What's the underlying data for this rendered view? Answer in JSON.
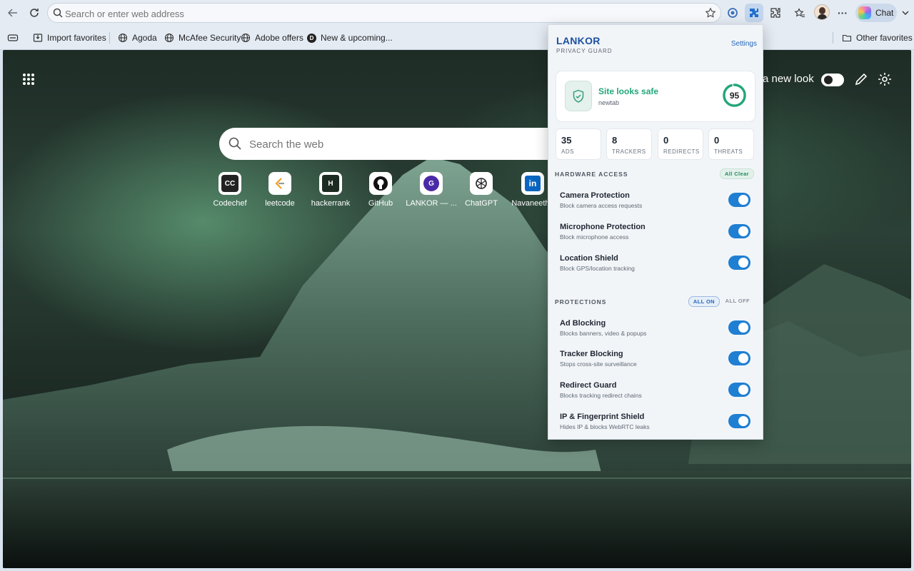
{
  "browser": {
    "address_placeholder": "Search or enter web address",
    "chat_label": "Chat",
    "more_label": "···"
  },
  "favorites": {
    "items": [
      {
        "label": "Import favorites",
        "icon": "import-icon"
      },
      {
        "label": "Agoda",
        "icon": "globe-icon"
      },
      {
        "label": "McAfee Security",
        "icon": "globe-icon"
      },
      {
        "label": "Adobe offers",
        "icon": "globe-icon"
      },
      {
        "label": "New & upcoming...",
        "icon": "d-logo-icon"
      }
    ],
    "other": "Other favorites"
  },
  "ntp": {
    "new_look_label": "a new look",
    "search_placeholder": "Search the web",
    "tiles": [
      {
        "label": "Codechef",
        "icon": "codechef-icon"
      },
      {
        "label": "leetcode",
        "icon": "leetcode-icon"
      },
      {
        "label": "hackerrank",
        "icon": "hackerrank-icon"
      },
      {
        "label": "GitHub",
        "icon": "github-icon"
      },
      {
        "label": "LANKOR — ...",
        "icon": "lankor-icon"
      },
      {
        "label": "ChatGPT",
        "icon": "chatgpt-icon"
      },
      {
        "label": "Navaneetha",
        "icon": "linkedin-icon"
      }
    ]
  },
  "popup": {
    "brand": "LANKOR",
    "subtitle": "PRIVACY GUARD",
    "settings": "Settings",
    "status_title": "Site looks safe",
    "status_site": "newtab",
    "score": "95",
    "score_fraction": 0.95,
    "stats": [
      {
        "value": "35",
        "label": "ADS"
      },
      {
        "value": "8",
        "label": "TRACKERS"
      },
      {
        "value": "0",
        "label": "REDIRECTS"
      },
      {
        "value": "0",
        "label": "THREATS"
      }
    ],
    "hardware": {
      "title": "HARDWARE ACCESS",
      "action": "All Clear",
      "rows": [
        {
          "title": "Camera Protection",
          "desc": "Block camera access requests",
          "on": true
        },
        {
          "title": "Microphone Protection",
          "desc": "Block microphone access",
          "on": true
        },
        {
          "title": "Location Shield",
          "desc": "Block GPS/location tracking",
          "on": true
        }
      ]
    },
    "protections": {
      "title": "PROTECTIONS",
      "all_on": "ALL ON",
      "all_off": "ALL OFF",
      "rows": [
        {
          "title": "Ad Blocking",
          "desc": "Blocks banners, video & popups",
          "on": true
        },
        {
          "title": "Tracker Blocking",
          "desc": "Stops cross-site surveillance",
          "on": true
        },
        {
          "title": "Redirect Guard",
          "desc": "Blocks tracking redirect chains",
          "on": true
        },
        {
          "title": "IP & Fingerprint Shield",
          "desc": "Hides IP & blocks WebRTC leaks",
          "on": true
        }
      ]
    },
    "colors": {
      "brand": "#1b4fa3",
      "safe": "#22a679",
      "toggle": "#1f7fd2"
    }
  }
}
